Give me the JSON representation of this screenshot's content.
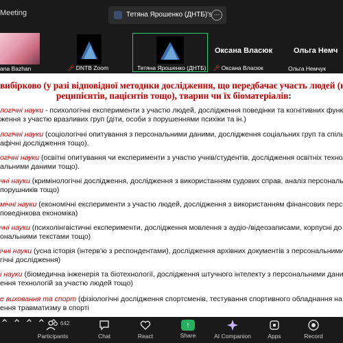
{
  "window": {
    "meeting_label": "Meeting"
  },
  "share_tab": {
    "title": "Тетяна Ярошенко (ДНТБ)'s scree",
    "more_icon": "ellipsis-icon"
  },
  "participants_strip": {
    "tiles": [
      {
        "label": "ana Bazhan",
        "muted": false
      },
      {
        "label": "DNTB Zoom",
        "muted": true
      },
      {
        "label": "Тетяна Ярошенко (ДНТБ)",
        "muted": false,
        "active": true
      },
      {
        "label": "Оксана Власюк",
        "muted": true,
        "display_name": "Оксана Власюк"
      },
      {
        "label": "Ольга Немчук",
        "muted": false,
        "display_name": "Ольга Немч"
      }
    ],
    "active_color": "#2ecc71",
    "mic_muted_color": "#e0443a"
  },
  "slide": {
    "heading_line1": "вибірково (у разі відповідної методики дослідження, що передбачає участь людей (клієн",
    "heading_line2": "реципієнтів, пацієнтів тощо), тварин чи їх біоматеріалів",
    "heading_colon": ":",
    "accent_color": "#c00000",
    "items": [
      {
        "term": "логічні науки",
        "line1_rest": " - психологічні експерименти з участю людей, дослідження поведінки та когнітивних функцій",
        "line2": "ження з участю вразливих груп (діти, особи з порушеннями психіки та ін.)"
      },
      {
        "term": "логічні науки",
        "line1_rest": " (соціологічні опитування з персональними даними, дослідження соціальних груп та спільно",
        "line2": "афічні дослідження тощо)."
      },
      {
        "term": "огічні науки",
        "line1_rest": " (освітні опитування чи експерименти з участю учнів/студентів, дослідження освітніх техноло",
        "line2": "альними даними тощо)."
      },
      {
        "term": "чні науки",
        "line1_rest": " (кримінологічні дослідження, дослідження з використанням судових справ, аналіз персональ",
        "line2": "порушників тощо)"
      },
      {
        "term": "мічні науки",
        "line1_rest": " (економічні експерименти з участю людей, дослідження з використанням фінансових персон",
        "line2": "поведінкова економіка)"
      },
      {
        "term": "чні науки",
        "line1_rest": " (психолінгвістичні експерименти, дослідження мовлення з аудіо-/відеозаписами, корпусні до",
        "line2": "ональними текстами тощо)"
      },
      {
        "term": "ічні науки",
        "line1_rest": " (усна історія (інтерв'ю з респондентами), дослідження архівних документів з персональними д",
        "line2": "гічні дослідження)"
      },
      {
        "term": "і науки",
        "line1_rest": " (біомедична інженерія та біотехнології, дослідження штучного інтелекту з персональними дани",
        "line2": "ення технологій за участю людей тощо)"
      },
      {
        "term": "е виховання та спорт",
        "line1_rest": " (фізіологічні дослідження спортсменів, тестування спортивного обладнання на л",
        "line2": "ення травматизму в спорті"
      }
    ]
  },
  "toolbar": {
    "participants": {
      "label": "Participants",
      "count": "642",
      "icon": "participants-icon"
    },
    "chat": {
      "label": "Chat",
      "icon": "chat-icon"
    },
    "react": {
      "label": "React",
      "icon": "heart-icon"
    },
    "share": {
      "label": "Share",
      "icon": "share-icon",
      "color": "#27ae60"
    },
    "ai_companion": {
      "label": "AI Companion",
      "icon": "sparkle-icon"
    },
    "apps": {
      "label": "Apps",
      "icon": "apps-icon"
    },
    "record": {
      "label": "Record",
      "icon": "record-icon"
    }
  }
}
